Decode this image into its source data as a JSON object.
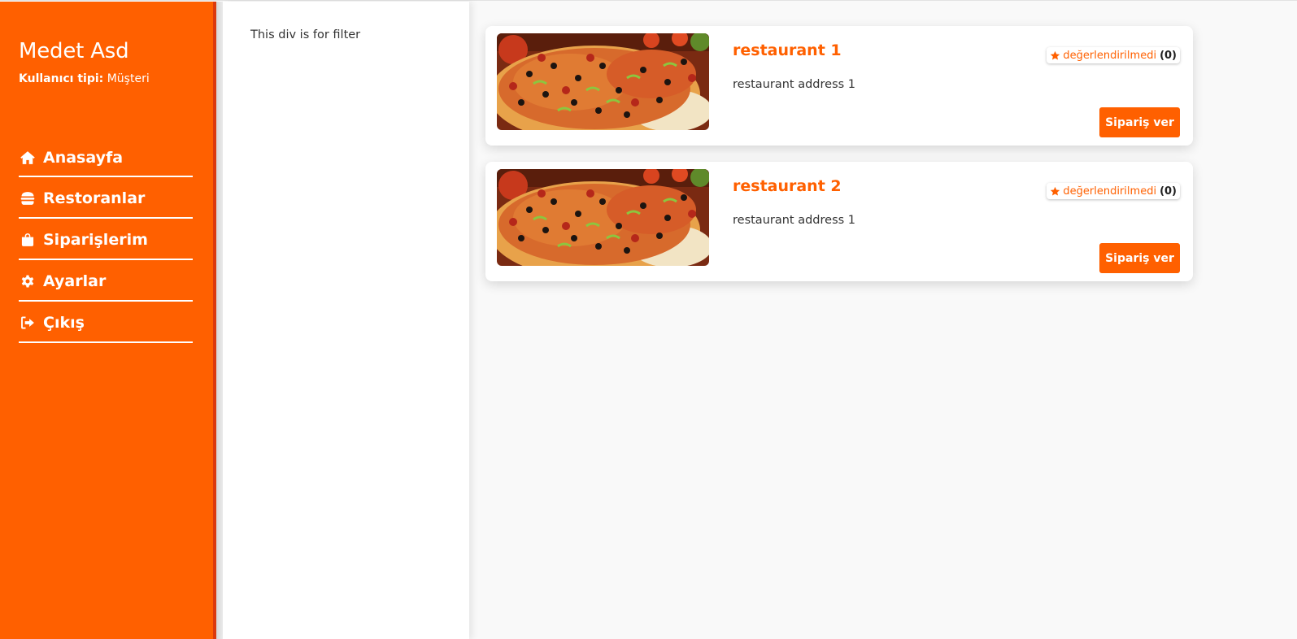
{
  "user": {
    "name": "Medet Asd",
    "type_label": "Kullanıcı tipi:",
    "type_value": "Müşteri"
  },
  "nav": {
    "items": [
      {
        "label": "Anasayfa",
        "icon": "home-icon"
      },
      {
        "label": "Restoranlar",
        "icon": "burger-icon"
      },
      {
        "label": "Siparişlerim",
        "icon": "shopping-bag-icon"
      },
      {
        "label": "Ayarlar",
        "icon": "gear-icon"
      },
      {
        "label": "Çıkış",
        "icon": "logout-icon"
      }
    ]
  },
  "filter": {
    "text": "This div is for filter"
  },
  "restaurants": [
    {
      "name": "restaurant 1",
      "address": "restaurant address 1",
      "rating_text": "değerlendirilmedi",
      "rating_count": "(0)",
      "order_label": "Sipariş ver"
    },
    {
      "name": "restaurant 2",
      "address": "restaurant address 1",
      "rating_text": "değerlendirilmedi",
      "rating_count": "(0)",
      "order_label": "Sipariş ver"
    }
  ],
  "colors": {
    "accent": "#ff6000",
    "sidebar_edge": "#dc3a0c"
  }
}
